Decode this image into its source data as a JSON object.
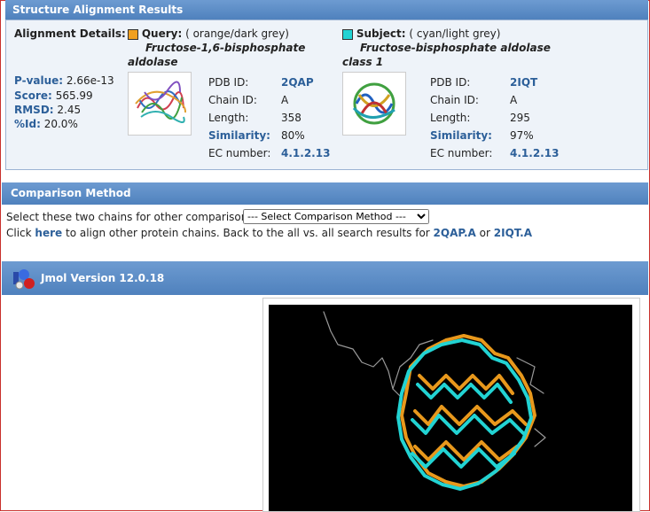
{
  "results": {
    "header": "Structure Alignment Results",
    "details_label": "Alignment Details:",
    "stats": [
      {
        "label": "P-value:",
        "value": "2.66e-13"
      },
      {
        "label": "Score:",
        "value": "565.99"
      },
      {
        "label": "RMSD:",
        "value": "2.45"
      },
      {
        "label": "%Id:",
        "value": "20.0%"
      }
    ],
    "query": {
      "title": "Query:",
      "color_desc": "( orange/dark grey)",
      "name_line1": "Fructose-1,6-bisphosphate",
      "name_line2": "aldolase",
      "swatch_color": "#f0a020",
      "fields": [
        {
          "label": "PDB ID:",
          "value": "2QAP",
          "label_style": "plain",
          "value_style": "link"
        },
        {
          "label": "Chain ID:",
          "value": "A",
          "label_style": "plain",
          "value_style": "plain"
        },
        {
          "label": "Length:",
          "value": "358",
          "label_style": "plain",
          "value_style": "plain"
        },
        {
          "label": "Similarity:",
          "value": "80%",
          "label_style": "blue",
          "value_style": "plain"
        },
        {
          "label": "EC number:",
          "value": "4.1.2.13",
          "label_style": "plain",
          "value_style": "link"
        }
      ]
    },
    "subject": {
      "title": "Subject:",
      "color_desc": "( cyan/light grey)",
      "name_line1": "Fructose-bisphosphate aldolase",
      "name_line2": "class 1",
      "swatch_color": "#22d3d3",
      "fields": [
        {
          "label": "PDB ID:",
          "value": "2IQT",
          "label_style": "plain",
          "value_style": "link"
        },
        {
          "label": "Chain ID:",
          "value": "A",
          "label_style": "plain",
          "value_style": "plain"
        },
        {
          "label": "Length:",
          "value": "295",
          "label_style": "plain",
          "value_style": "plain"
        },
        {
          "label": "Similarity:",
          "value": "97%",
          "label_style": "blue",
          "value_style": "plain"
        },
        {
          "label": "EC number:",
          "value": "4.1.2.13",
          "label_style": "plain",
          "value_style": "link"
        }
      ]
    }
  },
  "comparison": {
    "header": "Comparison Method",
    "select_prompt": "Select these two chains for other comparison:",
    "select_value": "--- Select Comparison Method ---",
    "click_text": "Click",
    "here_link": "here",
    "middle_text": "to align other protein chains. Back to the all vs. all search results for",
    "link1": "2QAP.A",
    "or_text": "or",
    "link2": "2IQT.A"
  },
  "jmol": {
    "header": "Jmol Version 12.0.18"
  },
  "colors": {
    "header_blue": "#4f81bd",
    "panel_bg": "#eef3f9",
    "link_blue": "#2c5f99",
    "orange": "#f0a020",
    "cyan": "#22d3d3"
  }
}
